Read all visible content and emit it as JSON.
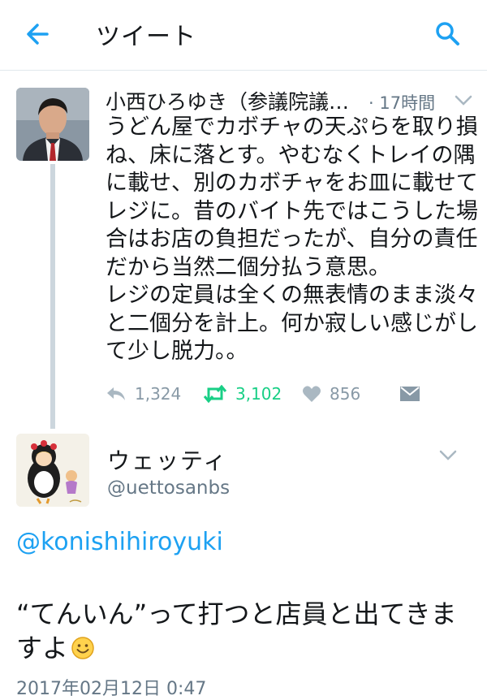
{
  "header": {
    "title": "ツイート",
    "back_icon": "arrow-left-icon",
    "search_icon": "search-icon",
    "accent": "#1da1f2"
  },
  "tweet1": {
    "author_name": "小西ひろゆき（参議院議…",
    "time": "· 17時間",
    "text": "うどん屋でカボチャの天ぷらを取り損ね、床に落とす。やむなくトレイの隅に載せ、別のカボチャをお皿に載せてレジに。昔のバイト先ではこうした場合はお店の負担だったが、自分の責任だから当然二個分払う意思。\nレジの定員は全くの無表情のまま淡々と二個分を計上。何か寂しい感じがして少し脱力。。",
    "reply_count": "1,324",
    "retweet_count": "3,102",
    "like_count": "856",
    "retweet_color": "#19cf86"
  },
  "tweet2": {
    "author_name": "ウェッティ",
    "handle": "@uettosanbs",
    "mention": "@konishihiroyuki",
    "text_before": "“てんいん”って打つと店員と出てきますよ",
    "emoji": "smiling-face-icon",
    "timestamp": "2017年02月12日 0:47"
  }
}
